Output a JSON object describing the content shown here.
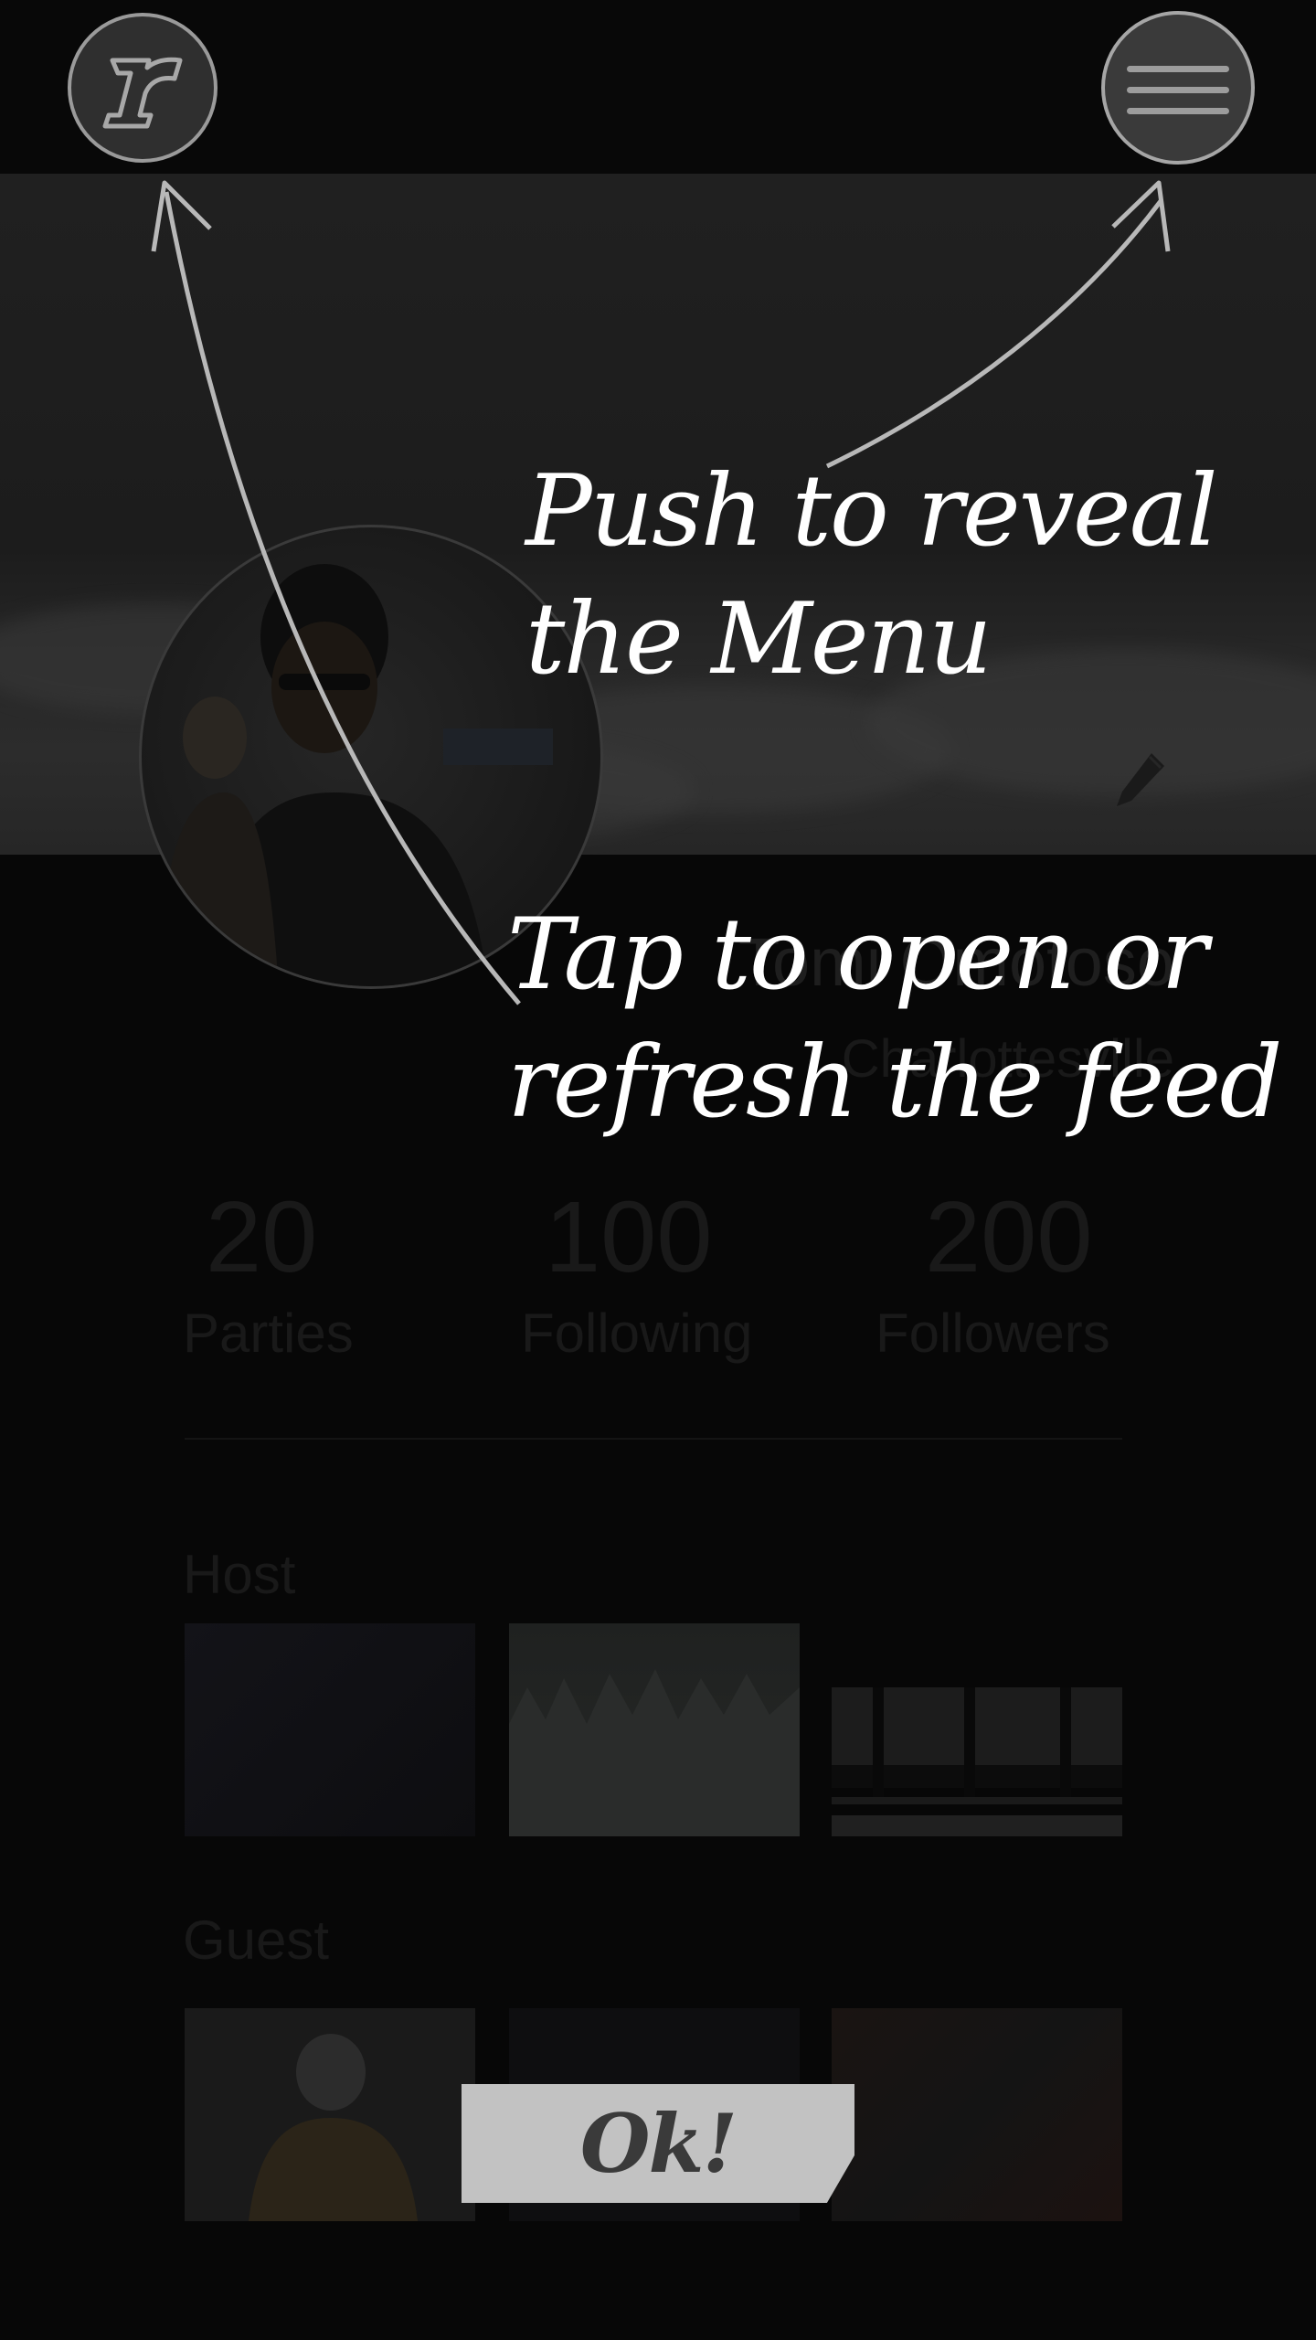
{
  "topbar": {
    "logo_letter": "r",
    "logo_icon": "brand-r-logo",
    "menu_icon": "hamburger-menu-icon"
  },
  "profile": {
    "name": "Tomi Omotoso",
    "city": "Charlottesville",
    "edit_icon": "pencil-icon"
  },
  "stats": [
    {
      "value": "20",
      "label": "Parties"
    },
    {
      "value": "100",
      "label": "Following"
    },
    {
      "value": "200",
      "label": "Followers"
    }
  ],
  "sections": {
    "host_title": "Host",
    "guest_title": "Guest"
  },
  "coach_marks": {
    "menu_hint_line1": "Push to reveal",
    "menu_hint_line2": "the Menu",
    "feed_hint_line1": "Tap to open or",
    "feed_hint_line2": "refresh the feed",
    "ok_label": "Ok!"
  }
}
